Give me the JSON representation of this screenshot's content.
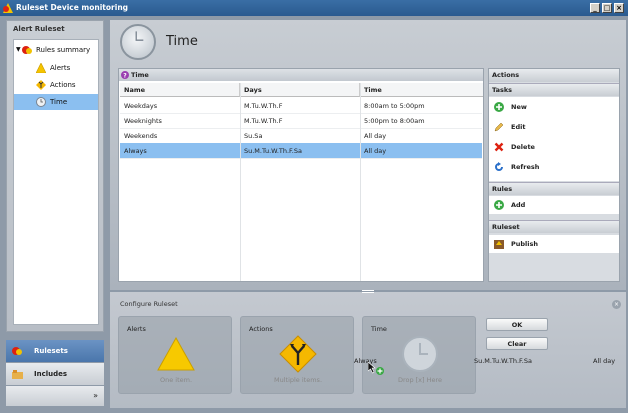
{
  "window": {
    "title": "Ruleset Device monitoring"
  },
  "left_panel": {
    "title": "Alert Ruleset",
    "tree": [
      {
        "label": "Rules summary"
      },
      {
        "label": "Alerts"
      },
      {
        "label": "Actions"
      },
      {
        "label": "Time",
        "selected": true
      }
    ]
  },
  "nav": {
    "rulesets": "Rulesets",
    "includes": "Includes",
    "more": "»"
  },
  "page": {
    "title": "Time"
  },
  "grid": {
    "panel_title": "Time",
    "columns": [
      "Name",
      "Days",
      "Time"
    ],
    "rows": [
      {
        "name": "Weekdays",
        "days": "M.Tu.W.Th.F",
        "time": "8:00am to 5:00pm"
      },
      {
        "name": "Weeknights",
        "days": "M.Tu.W.Th.F",
        "time": "5:00pm to 8:00am"
      },
      {
        "name": "Weekends",
        "days": "Su.Sa",
        "time": "All day"
      },
      {
        "name": "Always",
        "days": "Su.M.Tu.W.Th.F.Sa",
        "time": "All day",
        "selected": true
      }
    ]
  },
  "actions": {
    "title": "Actions",
    "tasks_header": "Tasks",
    "new": "New",
    "edit": "Edit",
    "delete": "Delete",
    "refresh": "Refresh",
    "rules_header": "Rules",
    "add": "Add",
    "ruleset_header": "Ruleset",
    "publish": "Publish"
  },
  "configure": {
    "title": "Configure Ruleset",
    "alerts_label": "Alerts",
    "alerts_sub": "One item.",
    "actions_label": "Actions",
    "actions_sub": "Multiple items.",
    "time_label": "Time",
    "time_sub": "Drop [x] Here",
    "drag_label": "Always",
    "drag_days": "Su.M.Tu.W.Th.F.Sa",
    "drag_time": "All day",
    "ok": "OK",
    "clear": "Clear"
  },
  "colors": {
    "selection": "#8bbff0",
    "titlebar": "#2a5a8f"
  }
}
